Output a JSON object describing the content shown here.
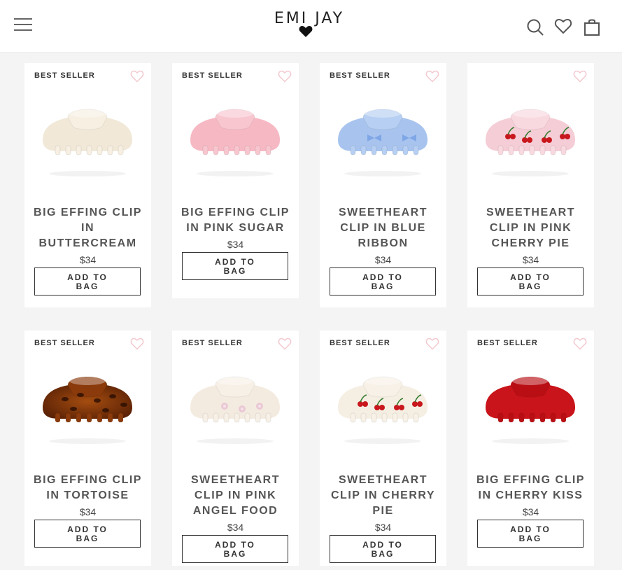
{
  "header": {
    "logo": "EMI JAY",
    "menu_icon": "hamburger-menu-icon",
    "search_icon": "search-icon",
    "wishlist_icon": "heart-icon",
    "cart_icon": "shopping-bag-icon"
  },
  "colors": {
    "text": "#555555",
    "heart_outline": "#f2c9cf",
    "background": "#f4f4f4"
  },
  "products": [
    {
      "badge": "BEST SELLER",
      "title_lines": [
        "BIG EFFING CLIP",
        "IN",
        "BUTTERCREAM"
      ],
      "price": "$34",
      "button_lines": [
        "ADD TO",
        "BAG"
      ],
      "image": "cream-claw-clip"
    },
    {
      "badge": "BEST SELLER",
      "title_lines": [
        "BIG EFFING CLIP",
        "IN PINK SUGAR"
      ],
      "price": "$34",
      "button_lines": [
        "ADD TO",
        "BAG"
      ],
      "image": "pink-claw-clip"
    },
    {
      "badge": "BEST SELLER",
      "title_lines": [
        "SWEETHEART",
        "CLIP IN BLUE",
        "RIBBON"
      ],
      "price": "$34",
      "button_lines": [
        "ADD TO",
        "BAG"
      ],
      "image": "blue-claw-clip"
    },
    {
      "badge": "",
      "title_lines": [
        "SWEETHEART",
        "CLIP IN PINK",
        "CHERRY PIE"
      ],
      "price": "$34",
      "button_lines": [
        "ADD TO",
        "BAG"
      ],
      "image": "pink-cherry-claw-clip"
    },
    {
      "badge": "BEST SELLER",
      "title_lines": [
        "BIG EFFING CLIP",
        "IN TORTOISE"
      ],
      "price": "$34",
      "button_lines": [
        "ADD TO",
        "BAG"
      ],
      "image": "tortoise-claw-clip"
    },
    {
      "badge": "BEST SELLER",
      "title_lines": [
        "SWEETHEART",
        "CLIP IN PINK",
        "ANGEL FOOD"
      ],
      "price": "$34",
      "button_lines": [
        "ADD TO",
        "BAG"
      ],
      "image": "angel-food-claw-clip"
    },
    {
      "badge": "BEST SELLER",
      "title_lines": [
        "SWEETHEART",
        "CLIP IN CHERRY",
        "PIE"
      ],
      "price": "$34",
      "button_lines": [
        "ADD TO",
        "BAG"
      ],
      "image": "cherry-pie-claw-clip"
    },
    {
      "badge": "BEST SELLER",
      "title_lines": [
        "BIG EFFING CLIP",
        "IN CHERRY KISS"
      ],
      "price": "$34",
      "button_lines": [
        "ADD TO",
        "BAG"
      ],
      "image": "red-claw-clip"
    }
  ]
}
